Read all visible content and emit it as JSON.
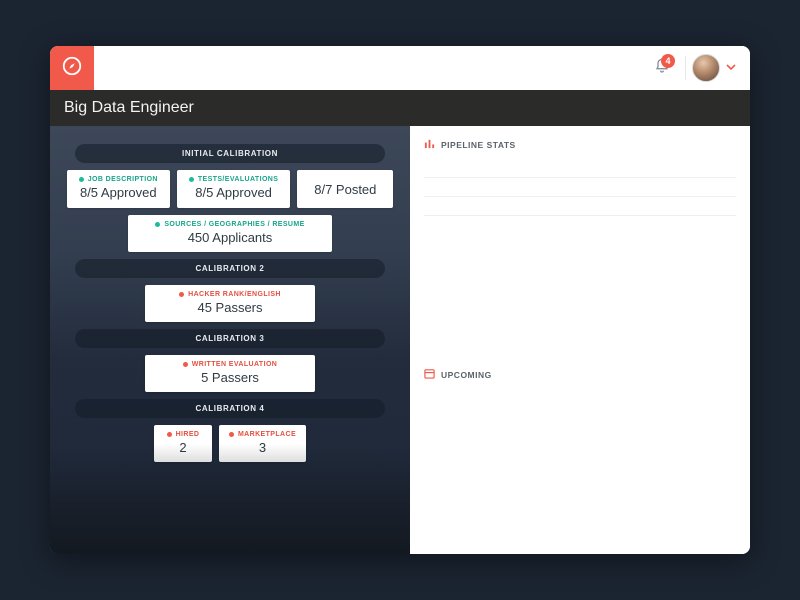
{
  "header": {
    "notification_count": "4"
  },
  "title": "Big Data Engineer",
  "pipeline": {
    "sections": [
      {
        "label": "INITIAL CALIBRATION",
        "cards": [
          {
            "dot": "green",
            "label": "JOB DESCRIPTION",
            "value": "8/5 Approved"
          },
          {
            "dot": "green",
            "label": "TESTS/EVALUATIONS",
            "value": "8/5 Approved"
          },
          {
            "dot": null,
            "label": "",
            "value": "8/7 Posted"
          }
        ],
        "cards2": [
          {
            "dot": "green",
            "label": "SOURCES / GEOGRAPHIES / RESUME",
            "value": "450 Applicants"
          }
        ]
      },
      {
        "label": "CALIBRATION 2",
        "cards": [
          {
            "dot": "red",
            "label": "HACKER RANK/ENGLISH",
            "value": "45 Passers"
          }
        ]
      },
      {
        "label": "CALIBRATION 3",
        "cards": [
          {
            "dot": "red",
            "label": "WRITTEN EVALUATION",
            "value": "5 Passers"
          }
        ]
      },
      {
        "label": "CALIBRATION 4",
        "cards": [
          {
            "dot": "red",
            "label": "HIRED",
            "value": "2"
          },
          {
            "dot": "red",
            "label": "MARKETPLACE",
            "value": "3"
          }
        ]
      }
    ]
  },
  "right": {
    "panel1_title": "PIPELINE STATS",
    "panel2_title": "UPCOMING"
  }
}
